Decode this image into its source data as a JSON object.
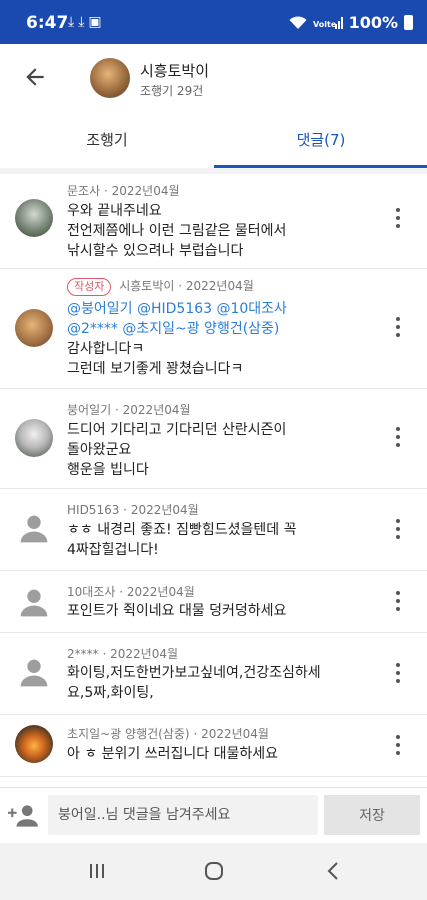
{
  "status_bar": {
    "time": "6:47",
    "battery": "100%",
    "icon_names": [
      "download-icon",
      "download-icon",
      "image-icon",
      "wifi-icon",
      "volte-icon",
      "signal-icon",
      "battery-icon"
    ]
  },
  "header": {
    "title": "시흥토박이",
    "subtitle": "조행기 29건"
  },
  "tabs": [
    {
      "label": "조행기",
      "active": false
    },
    {
      "label": "댓글(7)",
      "active": true
    }
  ],
  "comments": [
    {
      "author": "문조사",
      "date": "2022년04월",
      "lines": [
        "우와 끝내주네요",
        "전언제쯤에나 이런 그림같은 물터에서",
        "낚시할수 있으려나 부럽습니다"
      ]
    },
    {
      "badge": "작성자",
      "author": "시흥토박이",
      "date": "2022년04월",
      "mentions_1": "@붕어일기 @HID5163 @10대조사",
      "mentions_2": "@2**** @초지일~광 양행건(삼중)",
      "lines": [
        "감사합니다ㅋ",
        "그런데 보기좋게 꽝쳤습니다ㅋ"
      ]
    },
    {
      "author": "붕어일기",
      "date": "2022년04월",
      "lines": [
        "드디어 기다리고 기다리던 산란시즌이",
        "돌아왔군요",
        "행운을 빕니다"
      ]
    },
    {
      "author": "HID5163",
      "date": "2022년04월",
      "lines": [
        "ㅎㅎ 내경리 좋죠! 짐빵힘드셨을텐데 꼭",
        "4짜잡힐겁니다!"
      ]
    },
    {
      "author": "10대조사",
      "date": "2022년04월",
      "lines": [
        "포인트가 쥑이네요 대물 덩커덩하세요"
      ]
    },
    {
      "author": "2****",
      "date": "2022년04월",
      "lines": [
        "화이팅,저도한번가보고싶네여,건강조심하세",
        "요,5짜,화이팅,"
      ]
    },
    {
      "author": "초지일~광 양행건(삼중)",
      "date": "2022년04월",
      "lines": [
        "아 ㅎ 분위기 쓰러집니다 대물하세요"
      ]
    }
  ],
  "separator": "·",
  "input_bar": {
    "placeholder": "붕어일..님 댓글을 남겨주세요",
    "save_label": "저장"
  },
  "colors": {
    "status_bar": "#1a49b0",
    "accent": "#1a56b8",
    "mention": "#2a7ed8",
    "badge": "#e05a6a"
  }
}
